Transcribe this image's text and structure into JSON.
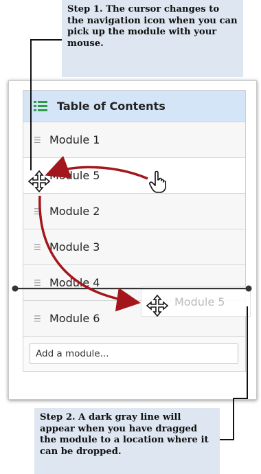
{
  "callouts": {
    "step1": "Step 1. The cursor changes to the navigation icon when you can pick up the module with your mouse.",
    "step2": "Step 2. A dark gray line will appear when you have dragged the module to a location where it can be dropped."
  },
  "toc": {
    "title": "Table of Contents",
    "icon": "list-icon",
    "modules": [
      {
        "label": "Module 1",
        "active": false
      },
      {
        "label": "Module 5",
        "active": true
      },
      {
        "label": "Module 2",
        "active": false
      },
      {
        "label": "Module 3",
        "active": false
      },
      {
        "label": "Module 4",
        "active": false
      },
      {
        "label": "Module 6",
        "active": false
      }
    ],
    "add_placeholder": "Add a module..."
  },
  "drag": {
    "ghost_label": "Module 5",
    "cursor_icons": [
      "move-cursor-icon",
      "hand-pointer-icon"
    ],
    "arrow_color": "#a3171c",
    "line_color": "#333333"
  },
  "colors": {
    "callout_bg": "#dde6f1",
    "header_bg": "#d4e5f7",
    "accent_green": "#2f9a47"
  }
}
